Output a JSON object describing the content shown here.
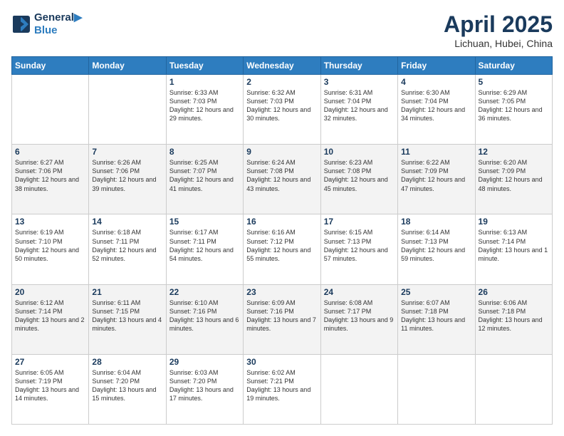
{
  "logo": {
    "line1": "General",
    "line2": "Blue"
  },
  "title": "April 2025",
  "location": "Lichuan, Hubei, China",
  "days_of_week": [
    "Sunday",
    "Monday",
    "Tuesday",
    "Wednesday",
    "Thursday",
    "Friday",
    "Saturday"
  ],
  "weeks": [
    [
      {
        "day": "",
        "sunrise": "",
        "sunset": "",
        "daylight": ""
      },
      {
        "day": "",
        "sunrise": "",
        "sunset": "",
        "daylight": ""
      },
      {
        "day": "1",
        "sunrise": "Sunrise: 6:33 AM",
        "sunset": "Sunset: 7:03 PM",
        "daylight": "Daylight: 12 hours and 29 minutes."
      },
      {
        "day": "2",
        "sunrise": "Sunrise: 6:32 AM",
        "sunset": "Sunset: 7:03 PM",
        "daylight": "Daylight: 12 hours and 30 minutes."
      },
      {
        "day": "3",
        "sunrise": "Sunrise: 6:31 AM",
        "sunset": "Sunset: 7:04 PM",
        "daylight": "Daylight: 12 hours and 32 minutes."
      },
      {
        "day": "4",
        "sunrise": "Sunrise: 6:30 AM",
        "sunset": "Sunset: 7:04 PM",
        "daylight": "Daylight: 12 hours and 34 minutes."
      },
      {
        "day": "5",
        "sunrise": "Sunrise: 6:29 AM",
        "sunset": "Sunset: 7:05 PM",
        "daylight": "Daylight: 12 hours and 36 minutes."
      }
    ],
    [
      {
        "day": "6",
        "sunrise": "Sunrise: 6:27 AM",
        "sunset": "Sunset: 7:06 PM",
        "daylight": "Daylight: 12 hours and 38 minutes."
      },
      {
        "day": "7",
        "sunrise": "Sunrise: 6:26 AM",
        "sunset": "Sunset: 7:06 PM",
        "daylight": "Daylight: 12 hours and 39 minutes."
      },
      {
        "day": "8",
        "sunrise": "Sunrise: 6:25 AM",
        "sunset": "Sunset: 7:07 PM",
        "daylight": "Daylight: 12 hours and 41 minutes."
      },
      {
        "day": "9",
        "sunrise": "Sunrise: 6:24 AM",
        "sunset": "Sunset: 7:08 PM",
        "daylight": "Daylight: 12 hours and 43 minutes."
      },
      {
        "day": "10",
        "sunrise": "Sunrise: 6:23 AM",
        "sunset": "Sunset: 7:08 PM",
        "daylight": "Daylight: 12 hours and 45 minutes."
      },
      {
        "day": "11",
        "sunrise": "Sunrise: 6:22 AM",
        "sunset": "Sunset: 7:09 PM",
        "daylight": "Daylight: 12 hours and 47 minutes."
      },
      {
        "day": "12",
        "sunrise": "Sunrise: 6:20 AM",
        "sunset": "Sunset: 7:09 PM",
        "daylight": "Daylight: 12 hours and 48 minutes."
      }
    ],
    [
      {
        "day": "13",
        "sunrise": "Sunrise: 6:19 AM",
        "sunset": "Sunset: 7:10 PM",
        "daylight": "Daylight: 12 hours and 50 minutes."
      },
      {
        "day": "14",
        "sunrise": "Sunrise: 6:18 AM",
        "sunset": "Sunset: 7:11 PM",
        "daylight": "Daylight: 12 hours and 52 minutes."
      },
      {
        "day": "15",
        "sunrise": "Sunrise: 6:17 AM",
        "sunset": "Sunset: 7:11 PM",
        "daylight": "Daylight: 12 hours and 54 minutes."
      },
      {
        "day": "16",
        "sunrise": "Sunrise: 6:16 AM",
        "sunset": "Sunset: 7:12 PM",
        "daylight": "Daylight: 12 hours and 55 minutes."
      },
      {
        "day": "17",
        "sunrise": "Sunrise: 6:15 AM",
        "sunset": "Sunset: 7:13 PM",
        "daylight": "Daylight: 12 hours and 57 minutes."
      },
      {
        "day": "18",
        "sunrise": "Sunrise: 6:14 AM",
        "sunset": "Sunset: 7:13 PM",
        "daylight": "Daylight: 12 hours and 59 minutes."
      },
      {
        "day": "19",
        "sunrise": "Sunrise: 6:13 AM",
        "sunset": "Sunset: 7:14 PM",
        "daylight": "Daylight: 13 hours and 1 minute."
      }
    ],
    [
      {
        "day": "20",
        "sunrise": "Sunrise: 6:12 AM",
        "sunset": "Sunset: 7:14 PM",
        "daylight": "Daylight: 13 hours and 2 minutes."
      },
      {
        "day": "21",
        "sunrise": "Sunrise: 6:11 AM",
        "sunset": "Sunset: 7:15 PM",
        "daylight": "Daylight: 13 hours and 4 minutes."
      },
      {
        "day": "22",
        "sunrise": "Sunrise: 6:10 AM",
        "sunset": "Sunset: 7:16 PM",
        "daylight": "Daylight: 13 hours and 6 minutes."
      },
      {
        "day": "23",
        "sunrise": "Sunrise: 6:09 AM",
        "sunset": "Sunset: 7:16 PM",
        "daylight": "Daylight: 13 hours and 7 minutes."
      },
      {
        "day": "24",
        "sunrise": "Sunrise: 6:08 AM",
        "sunset": "Sunset: 7:17 PM",
        "daylight": "Daylight: 13 hours and 9 minutes."
      },
      {
        "day": "25",
        "sunrise": "Sunrise: 6:07 AM",
        "sunset": "Sunset: 7:18 PM",
        "daylight": "Daylight: 13 hours and 11 minutes."
      },
      {
        "day": "26",
        "sunrise": "Sunrise: 6:06 AM",
        "sunset": "Sunset: 7:18 PM",
        "daylight": "Daylight: 13 hours and 12 minutes."
      }
    ],
    [
      {
        "day": "27",
        "sunrise": "Sunrise: 6:05 AM",
        "sunset": "Sunset: 7:19 PM",
        "daylight": "Daylight: 13 hours and 14 minutes."
      },
      {
        "day": "28",
        "sunrise": "Sunrise: 6:04 AM",
        "sunset": "Sunset: 7:20 PM",
        "daylight": "Daylight: 13 hours and 15 minutes."
      },
      {
        "day": "29",
        "sunrise": "Sunrise: 6:03 AM",
        "sunset": "Sunset: 7:20 PM",
        "daylight": "Daylight: 13 hours and 17 minutes."
      },
      {
        "day": "30",
        "sunrise": "Sunrise: 6:02 AM",
        "sunset": "Sunset: 7:21 PM",
        "daylight": "Daylight: 13 hours and 19 minutes."
      },
      {
        "day": "",
        "sunrise": "",
        "sunset": "",
        "daylight": ""
      },
      {
        "day": "",
        "sunrise": "",
        "sunset": "",
        "daylight": ""
      },
      {
        "day": "",
        "sunrise": "",
        "sunset": "",
        "daylight": ""
      }
    ]
  ]
}
